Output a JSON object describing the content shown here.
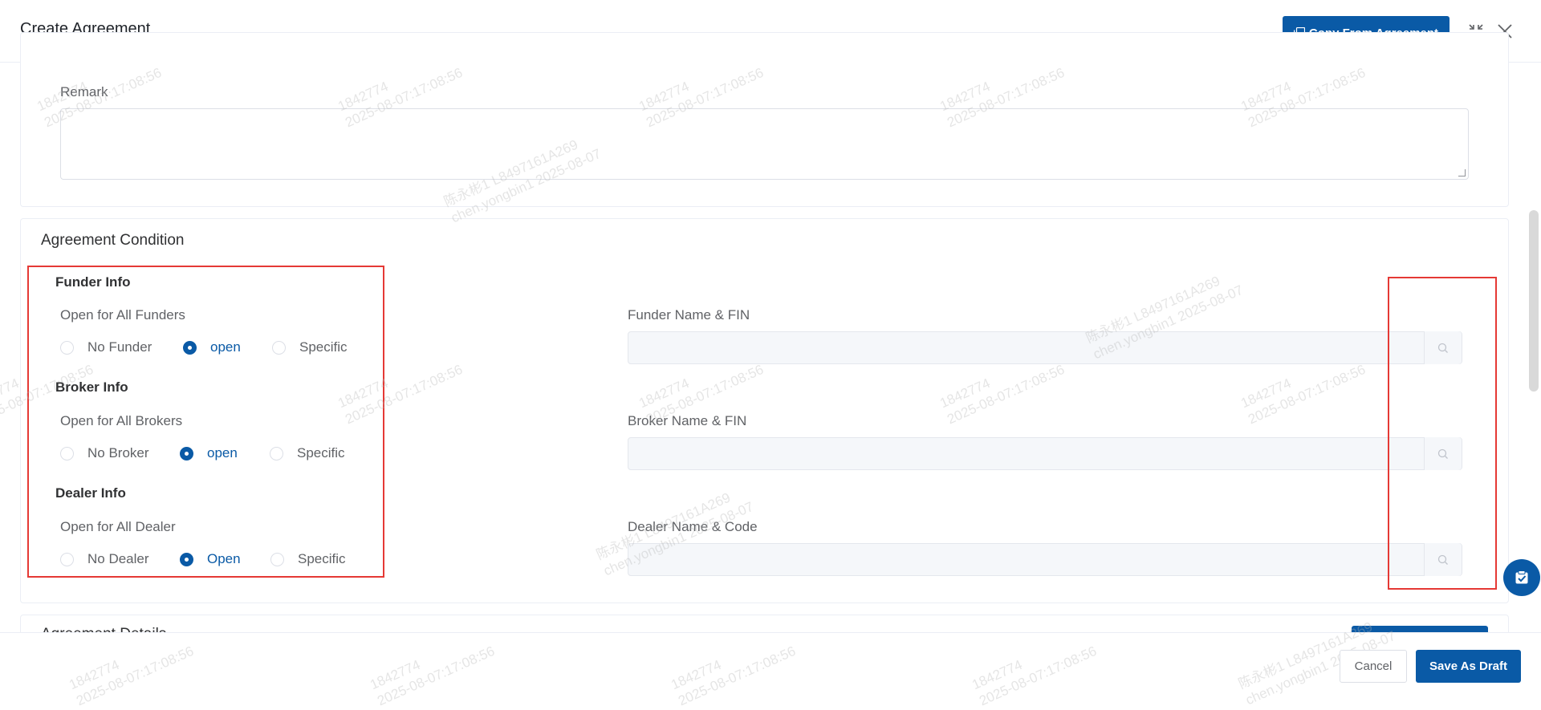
{
  "header": {
    "title": "Create Agreement",
    "copy_button_label": "Copy From Agreement"
  },
  "remark": {
    "label": "Remark",
    "value": ""
  },
  "agreement_condition": {
    "title": "Agreement Condition",
    "funder": {
      "group_title": "Funder Info",
      "question": "Open for All Funders",
      "options": [
        "No Funder",
        "open",
        "Specific"
      ],
      "selected": "open",
      "search_label": "Funder Name & FIN",
      "search_value": ""
    },
    "broker": {
      "group_title": "Broker Info",
      "question": "Open for All Brokers",
      "options": [
        "No Broker",
        "open",
        "Specific"
      ],
      "selected": "open",
      "search_label": "Broker Name & FIN",
      "search_value": ""
    },
    "dealer": {
      "group_title": "Dealer Info",
      "question": "Open for All Dealer",
      "options": [
        "No Dealer",
        "Open",
        "Specific"
      ],
      "selected": "Open",
      "search_label": "Dealer Name & Code",
      "search_value": ""
    }
  },
  "next_section": {
    "title": "Agreement Details"
  },
  "footer": {
    "cancel_label": "Cancel",
    "save_label": "Save As Draft"
  },
  "watermarks": {
    "id": "1842774",
    "timestamp": "2025-08-07:17:08:56",
    "name_line": "陈永彬1 L8497161A269",
    "user_line": "chen.yongbin1 2025-08-07"
  },
  "colors": {
    "primary": "#0a5aa6",
    "annotation": "#e53935"
  }
}
